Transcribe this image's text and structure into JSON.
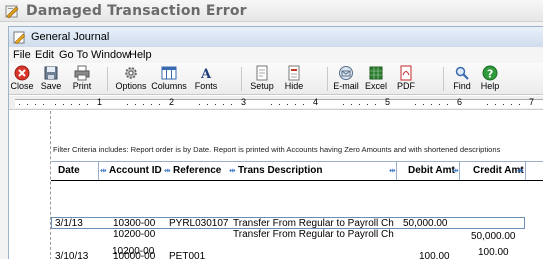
{
  "outer": {
    "title": "Damaged Transaction Error"
  },
  "window": {
    "title": "General Journal"
  },
  "menu": [
    "File",
    "Edit",
    "Go To",
    "Window",
    "Help"
  ],
  "toolbar": {
    "close": "Close",
    "save": "Save",
    "print": "Print",
    "options": "Options",
    "columns": "Columns",
    "fonts": "Fonts",
    "setup": "Setup",
    "hide": "Hide",
    "email": "E-mail",
    "excel": "Excel",
    "pdf": "PDF",
    "find": "Find",
    "help": "Help"
  },
  "ruler": [
    "1",
    "2",
    "3",
    "4",
    "5",
    "6",
    "7"
  ],
  "report": {
    "filter": "Filter Criteria includes: Report order is by Date. Report is printed with Accounts having Zero Amounts and with shortened descriptions",
    "columns": {
      "date": "Date",
      "account": "Account ID",
      "reference": "Reference",
      "description": "Trans Description",
      "debit": "Debit Amt",
      "credit": "Credit Amt"
    },
    "rows": [
      {
        "date": "3/1/13",
        "account": "10300-00",
        "reference": "PYRL030107",
        "description": "Transfer From Regular to Payroll Ch",
        "debit": "50,000.00",
        "credit": ""
      },
      {
        "date": "",
        "account": "10200-00",
        "reference": "",
        "description": "Transfer From Regular to Payroll Ch",
        "debit": "",
        "credit": "50,000.00"
      },
      {
        "date": "3/10/13",
        "account": "10000-00",
        "reference": "PET001",
        "description": "",
        "debit": "100.00",
        "credit": ""
      },
      {
        "date": "",
        "account": "10200-00",
        "reference": "",
        "description": "",
        "debit": "",
        "credit": "100.00"
      }
    ]
  },
  "colors": {
    "accent": "#2f6fc4",
    "close_red": "#d9362b",
    "help_green": "#2e9a3b",
    "excel_green": "#2e7d32",
    "pdf_red": "#c62828"
  }
}
